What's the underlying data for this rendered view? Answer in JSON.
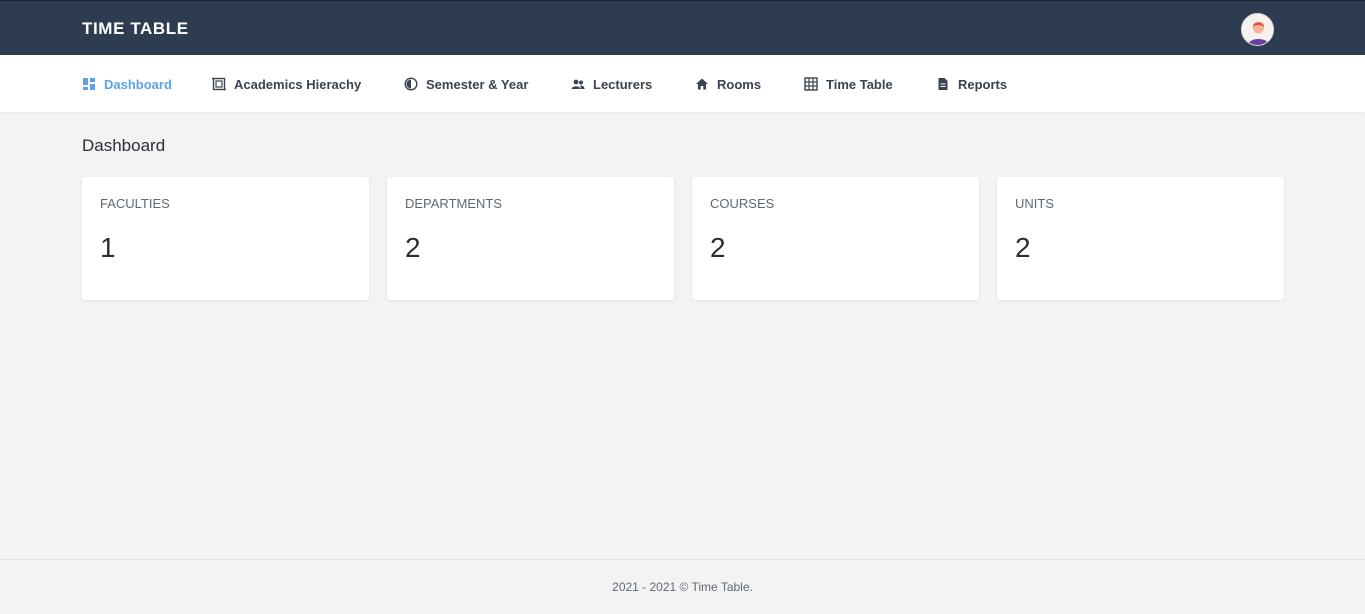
{
  "header": {
    "brand": "TIME TABLE",
    "avatar_icon": "user-avatar-icon"
  },
  "nav": {
    "items": [
      {
        "label": "Dashboard",
        "icon": "dashboard-icon",
        "active": true
      },
      {
        "label": "Academics Hierachy",
        "icon": "hierarchy-icon"
      },
      {
        "label": "Semester & Year",
        "icon": "half-circle-icon"
      },
      {
        "label": "Lecturers",
        "icon": "people-icon"
      },
      {
        "label": "Rooms",
        "icon": "home-icon"
      },
      {
        "label": "Time Table",
        "icon": "grid-icon"
      },
      {
        "label": "Reports",
        "icon": "document-icon"
      }
    ]
  },
  "main": {
    "title": "Dashboard",
    "cards": [
      {
        "label": "FACULTIES",
        "value": "1"
      },
      {
        "label": "DEPARTMENTS",
        "value": "2"
      },
      {
        "label": "COURSES",
        "value": "2"
      },
      {
        "label": "UNITS",
        "value": "2"
      }
    ]
  },
  "footer": {
    "text": "2021 - 2021 © Time Table."
  },
  "colors": {
    "topbar": "#2d3c50",
    "accent": "#5ca3e6",
    "background": "#f3f3f3"
  }
}
